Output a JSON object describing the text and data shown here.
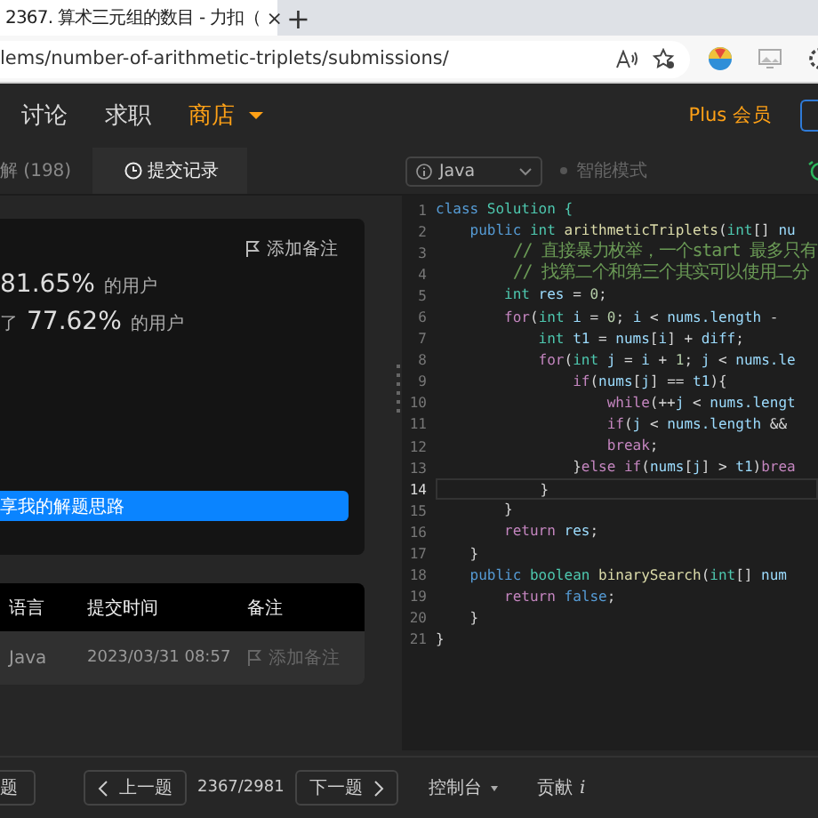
{
  "browser": {
    "tab_title": "2367. 算术三元组的数目 - 力扣（",
    "close": "×",
    "new_tab": "+",
    "address": "lems/number-of-arithmetic-triplets/submissions/"
  },
  "nav": {
    "items": [
      {
        "label": "讨论",
        "highlighted": false,
        "has_menu": false
      },
      {
        "label": "求职",
        "highlighted": false,
        "has_menu": false
      },
      {
        "label": "商店",
        "highlighted": true,
        "has_menu": true
      }
    ],
    "plus": "Plus 会员"
  },
  "panel_tabs": [
    {
      "label": "解 (198)",
      "selected": false,
      "kind": "plain"
    },
    {
      "label": "提交记录",
      "selected": true,
      "kind": "history"
    }
  ],
  "result": {
    "add_note": "添加备注",
    "stats": [
      {
        "value": "81.65%",
        "tail": "的用户"
      },
      {
        "lead": "了",
        "value": "77.62%",
        "tail": "的用户"
      }
    ],
    "share_button": "享我的解题思路"
  },
  "submissions": {
    "columns": [
      "语言",
      "提交时间",
      "备注"
    ],
    "rows": [
      {
        "language": "Java",
        "time": "2023/03/31 08:57",
        "note": "添加备注"
      }
    ]
  },
  "pager": {
    "left_cut": "题",
    "prev": "上一题",
    "counter": "2367/2981",
    "next": "下一题"
  },
  "editor": {
    "language": "Java",
    "mode": "智能模式",
    "lines": [
      {
        "number": "1",
        "current": false,
        "tokens": [
          {
            "text": "class ",
            "kind": "storage"
          },
          {
            "text": "Solution {",
            "kind": "type"
          }
        ]
      },
      {
        "number": "2",
        "current": false,
        "tokens": [
          {
            "text": "    public ",
            "kind": "storage"
          },
          {
            "text": "int ",
            "kind": "type"
          },
          {
            "text": "arithmeticTriplets",
            "kind": "function"
          },
          {
            "text": "(",
            "kind": "plain"
          },
          {
            "text": "int",
            "kind": "type"
          },
          {
            "text": "[] ",
            "kind": "plain"
          },
          {
            "text": "nu",
            "kind": "variable"
          }
        ]
      },
      {
        "number": "3",
        "current": false,
        "tokens": [
          {
            "text": "        // 直接暴力枚举，一个start 最多只有",
            "kind": "comment"
          }
        ]
      },
      {
        "number": "4",
        "current": false,
        "tokens": [
          {
            "text": "        // 找第二个和第三个其实可以使用二分",
            "kind": "comment"
          }
        ]
      },
      {
        "number": "5",
        "current": false,
        "tokens": [
          {
            "text": "        int ",
            "kind": "type"
          },
          {
            "text": "res",
            "kind": "variable"
          },
          {
            "text": " = ",
            "kind": "plain"
          },
          {
            "text": "0",
            "kind": "number"
          },
          {
            "text": ";",
            "kind": "plain"
          }
        ]
      },
      {
        "number": "6",
        "current": false,
        "tokens": [
          {
            "text": "        for",
            "kind": "keyword"
          },
          {
            "text": "(",
            "kind": "plain"
          },
          {
            "text": "int ",
            "kind": "type"
          },
          {
            "text": "i",
            "kind": "variable"
          },
          {
            "text": " = ",
            "kind": "plain"
          },
          {
            "text": "0",
            "kind": "number"
          },
          {
            "text": "; ",
            "kind": "plain"
          },
          {
            "text": "i",
            "kind": "variable"
          },
          {
            "text": " < ",
            "kind": "plain"
          },
          {
            "text": "nums.length",
            "kind": "variable"
          },
          {
            "text": " -",
            "kind": "plain"
          }
        ]
      },
      {
        "number": "7",
        "current": false,
        "tokens": [
          {
            "text": "            int ",
            "kind": "type"
          },
          {
            "text": "t1",
            "kind": "variable"
          },
          {
            "text": " = ",
            "kind": "plain"
          },
          {
            "text": "nums",
            "kind": "variable"
          },
          {
            "text": "[",
            "kind": "plain"
          },
          {
            "text": "i",
            "kind": "variable"
          },
          {
            "text": "] + ",
            "kind": "plain"
          },
          {
            "text": "diff",
            "kind": "variable"
          },
          {
            "text": ";",
            "kind": "plain"
          }
        ]
      },
      {
        "number": "8",
        "current": false,
        "tokens": [
          {
            "text": "            for",
            "kind": "keyword"
          },
          {
            "text": "(",
            "kind": "plain"
          },
          {
            "text": "int ",
            "kind": "type"
          },
          {
            "text": "j",
            "kind": "variable"
          },
          {
            "text": " = ",
            "kind": "plain"
          },
          {
            "text": "i",
            "kind": "variable"
          },
          {
            "text": " + ",
            "kind": "plain"
          },
          {
            "text": "1",
            "kind": "number"
          },
          {
            "text": "; ",
            "kind": "plain"
          },
          {
            "text": "j",
            "kind": "variable"
          },
          {
            "text": " < ",
            "kind": "plain"
          },
          {
            "text": "nums.le",
            "kind": "variable"
          }
        ]
      },
      {
        "number": "9",
        "current": false,
        "tokens": [
          {
            "text": "                if",
            "kind": "keyword"
          },
          {
            "text": "(",
            "kind": "plain"
          },
          {
            "text": "nums",
            "kind": "variable"
          },
          {
            "text": "[",
            "kind": "plain"
          },
          {
            "text": "j",
            "kind": "variable"
          },
          {
            "text": "] == ",
            "kind": "plain"
          },
          {
            "text": "t1",
            "kind": "variable"
          },
          {
            "text": "){",
            "kind": "plain"
          }
        ]
      },
      {
        "number": "10",
        "current": false,
        "tokens": [
          {
            "text": "                    while",
            "kind": "keyword"
          },
          {
            "text": "(++",
            "kind": "plain"
          },
          {
            "text": "j",
            "kind": "variable"
          },
          {
            "text": " < ",
            "kind": "plain"
          },
          {
            "text": "nums.lengt",
            "kind": "variable"
          }
        ]
      },
      {
        "number": "11",
        "current": false,
        "tokens": [
          {
            "text": "                    if",
            "kind": "keyword"
          },
          {
            "text": "(",
            "kind": "plain"
          },
          {
            "text": "j",
            "kind": "variable"
          },
          {
            "text": " < ",
            "kind": "plain"
          },
          {
            "text": "nums.length",
            "kind": "variable"
          },
          {
            "text": " &&",
            "kind": "plain"
          }
        ]
      },
      {
        "number": "12",
        "current": false,
        "tokens": [
          {
            "text": "                    break",
            "kind": "keyword"
          },
          {
            "text": ";",
            "kind": "plain"
          }
        ]
      },
      {
        "number": "13",
        "current": false,
        "tokens": [
          {
            "text": "                }",
            "kind": "plain"
          },
          {
            "text": "else if",
            "kind": "keyword"
          },
          {
            "text": "(",
            "kind": "plain"
          },
          {
            "text": "nums",
            "kind": "variable"
          },
          {
            "text": "[",
            "kind": "plain"
          },
          {
            "text": "j",
            "kind": "variable"
          },
          {
            "text": "] > ",
            "kind": "plain"
          },
          {
            "text": "t1",
            "kind": "variable"
          },
          {
            "text": ")",
            "kind": "plain"
          },
          {
            "text": "brea",
            "kind": "keyword"
          }
        ]
      },
      {
        "number": "14",
        "current": true,
        "tokens": [
          {
            "text": "            }",
            "kind": "plain"
          }
        ]
      },
      {
        "number": "15",
        "current": false,
        "tokens": [
          {
            "text": "        }",
            "kind": "plain"
          }
        ]
      },
      {
        "number": "16",
        "current": false,
        "tokens": [
          {
            "text": "        return ",
            "kind": "keyword"
          },
          {
            "text": "res",
            "kind": "variable"
          },
          {
            "text": ";",
            "kind": "plain"
          }
        ]
      },
      {
        "number": "17",
        "current": false,
        "tokens": [
          {
            "text": "    }",
            "kind": "plain"
          }
        ]
      },
      {
        "number": "18",
        "current": false,
        "tokens": [
          {
            "text": "    public ",
            "kind": "storage"
          },
          {
            "text": "boolean ",
            "kind": "type"
          },
          {
            "text": "binarySearch",
            "kind": "function"
          },
          {
            "text": "(",
            "kind": "plain"
          },
          {
            "text": "int",
            "kind": "type"
          },
          {
            "text": "[] ",
            "kind": "plain"
          },
          {
            "text": "num",
            "kind": "variable"
          }
        ]
      },
      {
        "number": "19",
        "current": false,
        "tokens": [
          {
            "text": "        return ",
            "kind": "keyword"
          },
          {
            "text": "false",
            "kind": "storage"
          },
          {
            "text": ";",
            "kind": "plain"
          }
        ]
      },
      {
        "number": "20",
        "current": false,
        "tokens": [
          {
            "text": "    }",
            "kind": "plain"
          }
        ]
      },
      {
        "number": "21",
        "current": false,
        "tokens": [
          {
            "text": "}",
            "kind": "plain"
          }
        ]
      }
    ]
  },
  "editor_footer": {
    "console": "控制台",
    "contribute": "贡献",
    "info": "i"
  }
}
